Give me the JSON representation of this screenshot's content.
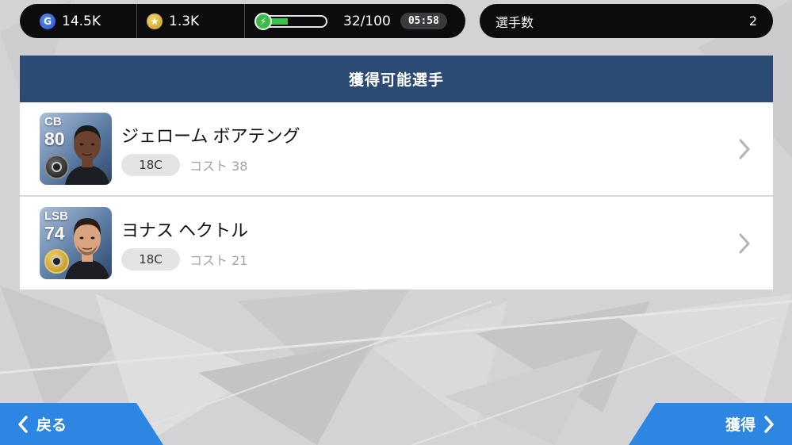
{
  "top_bar": {
    "gp_icon_glyph": "G",
    "gp_value": "14.5K",
    "coin_icon_glyph": "★",
    "coin_value": "1.3K",
    "energy_icon_glyph": "⚡",
    "energy_fraction": 0.32,
    "energy_value": "32/100",
    "timer": "05:58",
    "player_count_label": "選手数",
    "player_count_value": "2"
  },
  "panel": {
    "title": "獲得可能選手",
    "players": [
      {
        "position": "CB",
        "rating": "80",
        "name": "ジェローム ボアテング",
        "tag": "18C",
        "cost": "コスト 38",
        "badge": "black-badge-icon",
        "skin": "#6b4330",
        "hair": "#1a1a1a"
      },
      {
        "position": "LSB",
        "rating": "74",
        "name": "ヨナス ヘクトル",
        "tag": "18C",
        "cost": "コスト 21",
        "badge": "gold-badge-icon",
        "skin": "#d9a47f",
        "hair": "#2a1d15"
      }
    ]
  },
  "footer": {
    "back_label": "戻る",
    "get_label": "獲得"
  },
  "colors": {
    "header_bg": "#2c4b74",
    "button_bg": "#2d86e2",
    "energy_green": "#39c34a"
  }
}
